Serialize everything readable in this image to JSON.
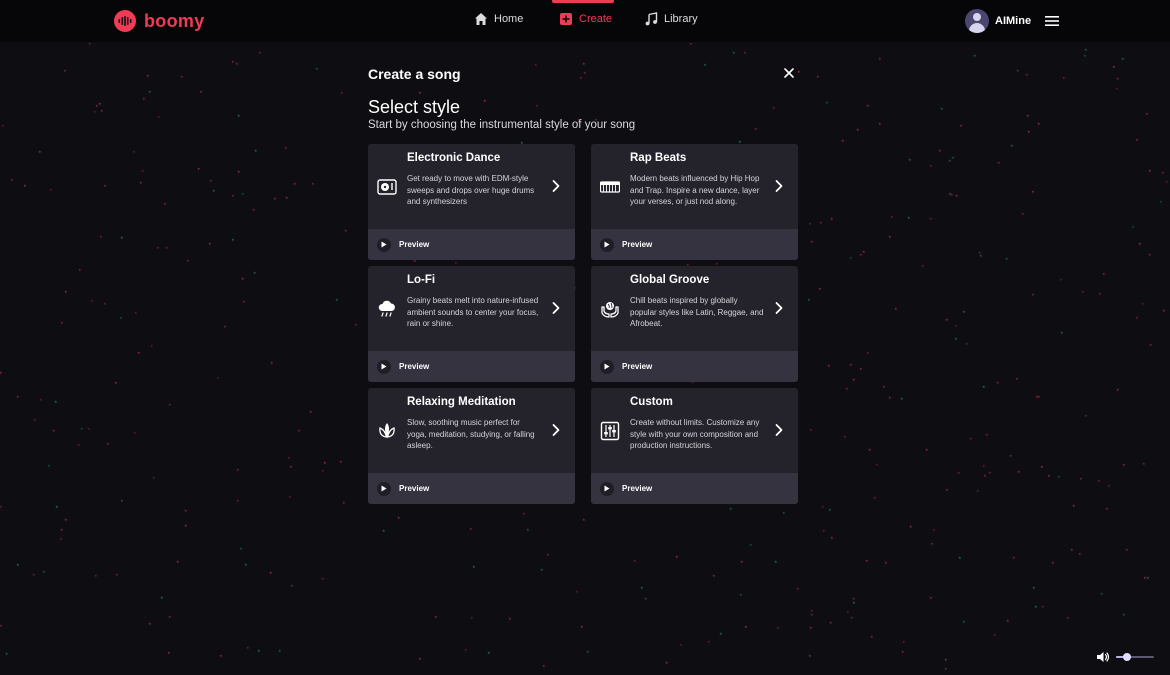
{
  "app": {
    "logo_text": "boomy",
    "brand_color": "#ef3b55"
  },
  "nav": {
    "items": [
      {
        "label": "Home",
        "icon": "home-icon",
        "active": false
      },
      {
        "label": "Create",
        "icon": "plus-square-icon",
        "active": true
      },
      {
        "label": "Library",
        "icon": "music-note-icon",
        "active": false
      }
    ]
  },
  "user": {
    "name": "AIMine",
    "avatar_icon": "user-avatar-icon",
    "menu_icon": "hamburger-menu-icon"
  },
  "panel": {
    "title": "Create a song",
    "close_icon": "close-icon",
    "heading": "Select style",
    "subheading": "Start by choosing the instrumental style of your song"
  },
  "styles": [
    {
      "title": "Electronic Dance",
      "description": "Get ready to move with EDM-style sweeps and drops over huge drums and synthesizers",
      "icon": "turntable-icon",
      "preview_label": "Preview"
    },
    {
      "title": "Rap Beats",
      "description": "Modern beats influenced by Hip Hop and Trap. Inspire a new dance, layer your verses, or just nod along.",
      "icon": "keyboard-icon",
      "preview_label": "Preview"
    },
    {
      "title": "Lo-Fi",
      "description": "Grainy beats melt into nature-infused ambient sounds to center your focus, rain or shine.",
      "icon": "rain-cloud-icon",
      "preview_label": "Preview"
    },
    {
      "title": "Global Groove",
      "description": "Chill beats inspired by globally popular styles like Latin, Reggae, and Afrobeat.",
      "icon": "globe-hands-icon",
      "preview_label": "Preview"
    },
    {
      "title": "Relaxing Meditation",
      "description": "Slow, soothing music perfect for yoga, meditation, studying, or falling asleep.",
      "icon": "lotus-icon",
      "preview_label": "Preview"
    },
    {
      "title": "Custom",
      "description": "Create without limits. Customize any style with your own composition and production instructions.",
      "icon": "sliders-icon",
      "preview_label": "Preview"
    }
  ],
  "volume": {
    "icon": "volume-icon",
    "level": 0.3
  },
  "colors": {
    "background": "#0e0d12",
    "card": "#24232b",
    "card_footer": "#34333f",
    "star_red": "#c23a4a",
    "star_green": "#2e8f6e"
  }
}
